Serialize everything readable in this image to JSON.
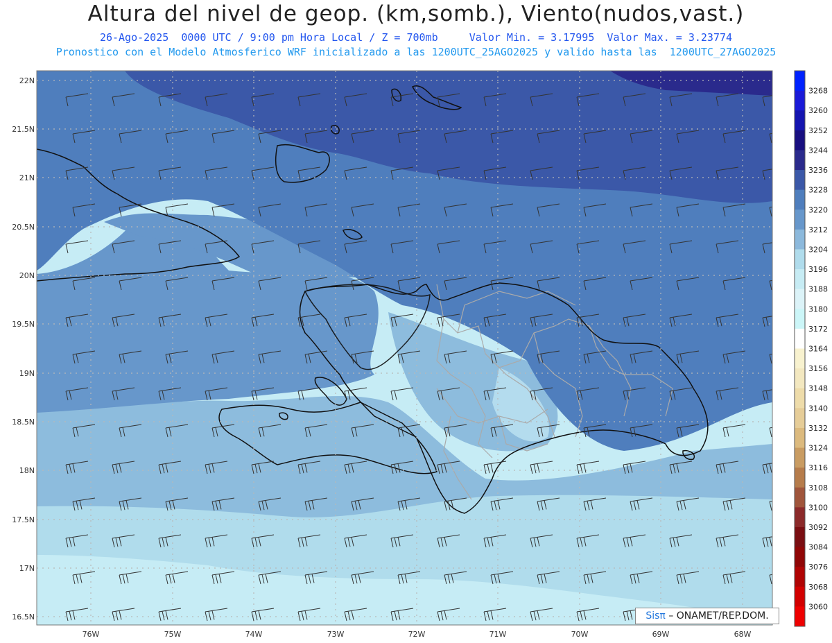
{
  "header": {
    "title": "Altura del nivel de geop. (km,somb.), Viento(nudos,vast.)",
    "line1": "26-Ago-2025  0000 UTC / 9:00 pm Hora Local / Z = 700mb     Valor Min. = 3.17995  Valor Max. = 3.23774",
    "line2": "Pronostico con el Modelo Atmosferico WRF inicializado a las 1200UTC_25AGO2025 y valido hasta las  1200UTC_27AGO2025"
  },
  "map": {
    "lat_labels": [
      "22N",
      "21.5N",
      "21N",
      "20.5N",
      "20N",
      "19.5N",
      "19N",
      "18.5N",
      "18N",
      "17.5N",
      "17N",
      "16.5N"
    ],
    "lon_labels": [
      "76W",
      "75W",
      "74W",
      "73W",
      "72W",
      "71W",
      "70W",
      "69W",
      "68W"
    ]
  },
  "colorbar": {
    "labels": [
      "3268",
      "3260",
      "3252",
      "3244",
      "3236",
      "3228",
      "3220",
      "3212",
      "3204",
      "3196",
      "3188",
      "3180",
      "3172",
      "3164",
      "3156",
      "3148",
      "3140",
      "3132",
      "3124",
      "3116",
      "3108",
      "3100",
      "3092",
      "3084",
      "3076",
      "3068",
      "3060"
    ],
    "colors": [
      "#0022ff",
      "#1a1ad8",
      "#1515b0",
      "#180f80",
      "#2a2a8c",
      "#3b58a8",
      "#4f7ebd",
      "#6797cb",
      "#8cb9dc",
      "#b0dcec",
      "#c7ecf4",
      "#dcf3f8",
      "#ccf6f8",
      "#ffffff",
      "#f8f2cf",
      "#f3e8c0",
      "#eedcaa",
      "#e6cd98",
      "#dcba7e",
      "#c99c62",
      "#b67c4b",
      "#a0553b",
      "#8c2a2a",
      "#7a0e12",
      "#900606",
      "#b00404",
      "#d20000",
      "#ee0000"
    ]
  },
  "credit": {
    "sis": "Sisπ",
    "rest": "– ONAMET/REP.DOM."
  }
}
